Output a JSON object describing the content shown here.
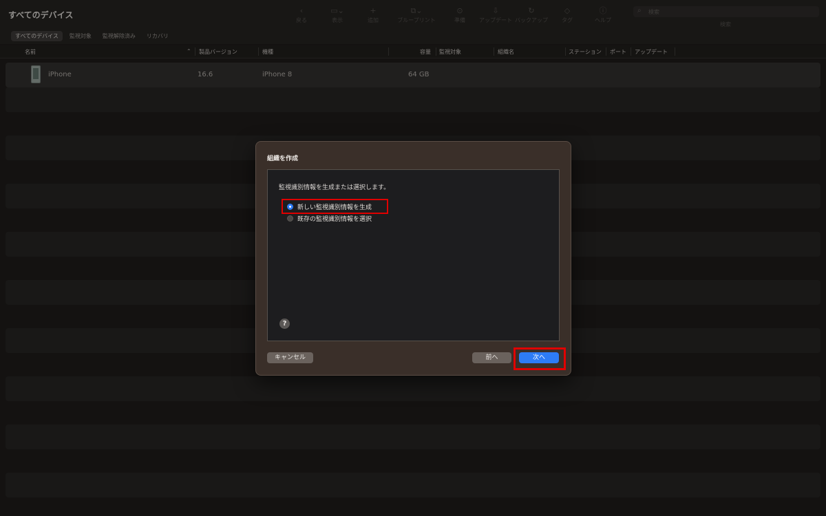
{
  "window": {
    "title": "すべてのデバイス"
  },
  "filters": [
    "すべてのデバイス",
    "監視対象",
    "監視解除済み",
    "リカバリ"
  ],
  "toolbar": {
    "items": [
      {
        "label": "戻る",
        "icon": "chevron-left-icon"
      },
      {
        "label": "表示",
        "icon": "view-icon"
      },
      {
        "label": "追加",
        "icon": "plus-icon"
      },
      {
        "label": "ブループリント",
        "icon": "blueprint-icon"
      },
      {
        "label": "準備",
        "icon": "prepare-icon"
      },
      {
        "label": "アップデート",
        "icon": "update-icon"
      },
      {
        "label": "バックアップ",
        "icon": "backup-icon"
      },
      {
        "label": "タグ",
        "icon": "tag-icon"
      },
      {
        "label": "ヘルプ",
        "icon": "help-icon"
      }
    ],
    "search_placeholder": "検索",
    "search_label": "検索"
  },
  "columns": [
    "名前",
    "製品バージョン",
    "機種",
    "容量",
    "監視対象",
    "組織名",
    "ステーション",
    "ポート",
    "アップデート"
  ],
  "devices": [
    {
      "name": "iPhone",
      "version": "16.6",
      "model": "iPhone 8",
      "capacity": "64 GB"
    }
  ],
  "dialog": {
    "title": "組織を作成",
    "prompt": "監視識別情報を生成または選択します。",
    "options": [
      {
        "label": "新しい監視識別情報を生成",
        "selected": true
      },
      {
        "label": "既存の監視識別情報を選択",
        "selected": false
      }
    ],
    "help": "?",
    "cancel": "キャンセル",
    "back": "前へ",
    "next": "次へ"
  },
  "colors": {
    "accent": "#2d7cf6",
    "highlight": "#e00000"
  }
}
